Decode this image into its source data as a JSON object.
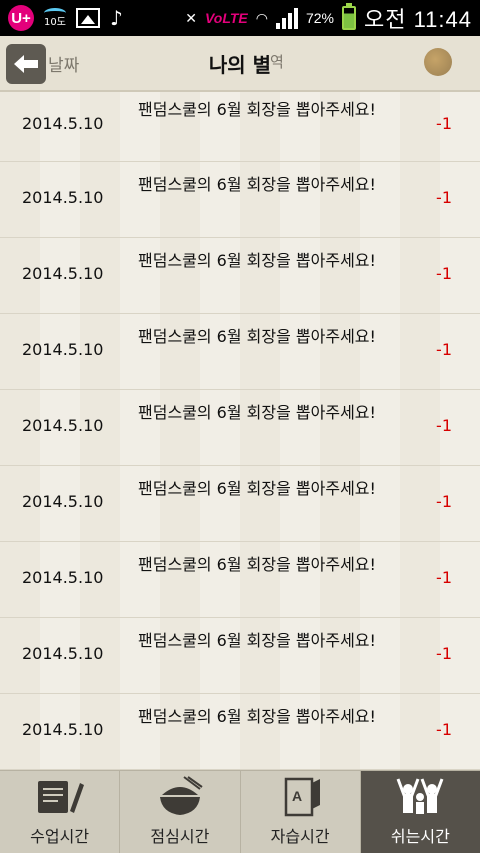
{
  "status_bar": {
    "carrier_logo": "U+",
    "weather_temp": "10도",
    "network": "VoLTE",
    "battery_percent": "72%",
    "time": "오전 11:44"
  },
  "header": {
    "col_date": "날짜",
    "title": "나의 별",
    "col_history": "역"
  },
  "rows": [
    {
      "date": "2014.5.10",
      "title": "팬덤스쿨의 6월 회장을 뽑아주세요!",
      "amount": "-1"
    },
    {
      "date": "2014.5.10",
      "title": "팬덤스쿨의 6월 회장을 뽑아주세요!",
      "amount": "-1"
    },
    {
      "date": "2014.5.10",
      "title": "팬덤스쿨의 6월 회장을 뽑아주세요!",
      "amount": "-1"
    },
    {
      "date": "2014.5.10",
      "title": "팬덤스쿨의 6월 회장을 뽑아주세요!",
      "amount": "-1"
    },
    {
      "date": "2014.5.10",
      "title": "팬덤스쿨의 6월 회장을 뽑아주세요!",
      "amount": "-1"
    },
    {
      "date": "2014.5.10",
      "title": "팬덤스쿨의 6월 회장을 뽑아주세요!",
      "amount": "-1"
    },
    {
      "date": "2014.5.10",
      "title": "팬덤스쿨의 6월 회장을 뽑아주세요!",
      "amount": "-1"
    },
    {
      "date": "2014.5.10",
      "title": "팬덤스쿨의 6월 회장을 뽑아주세요!",
      "amount": "-1"
    },
    {
      "date": "2014.5.10",
      "title": "팬덤스쿨의 6월 회장을 뽑아주세요!",
      "amount": "-1"
    }
  ],
  "bottom_nav": {
    "tabs": [
      {
        "label": "수업시간",
        "icon": "notebook-pen-icon"
      },
      {
        "label": "점심시간",
        "icon": "rice-bowl-icon"
      },
      {
        "label": "자습시간",
        "icon": "study-paper-icon"
      },
      {
        "label": "쉬는시간",
        "icon": "cheering-people-icon",
        "active": true
      }
    ]
  },
  "colors": {
    "amount": "#d60000",
    "background": "#ece8dd",
    "active_tab": "#55514a"
  }
}
